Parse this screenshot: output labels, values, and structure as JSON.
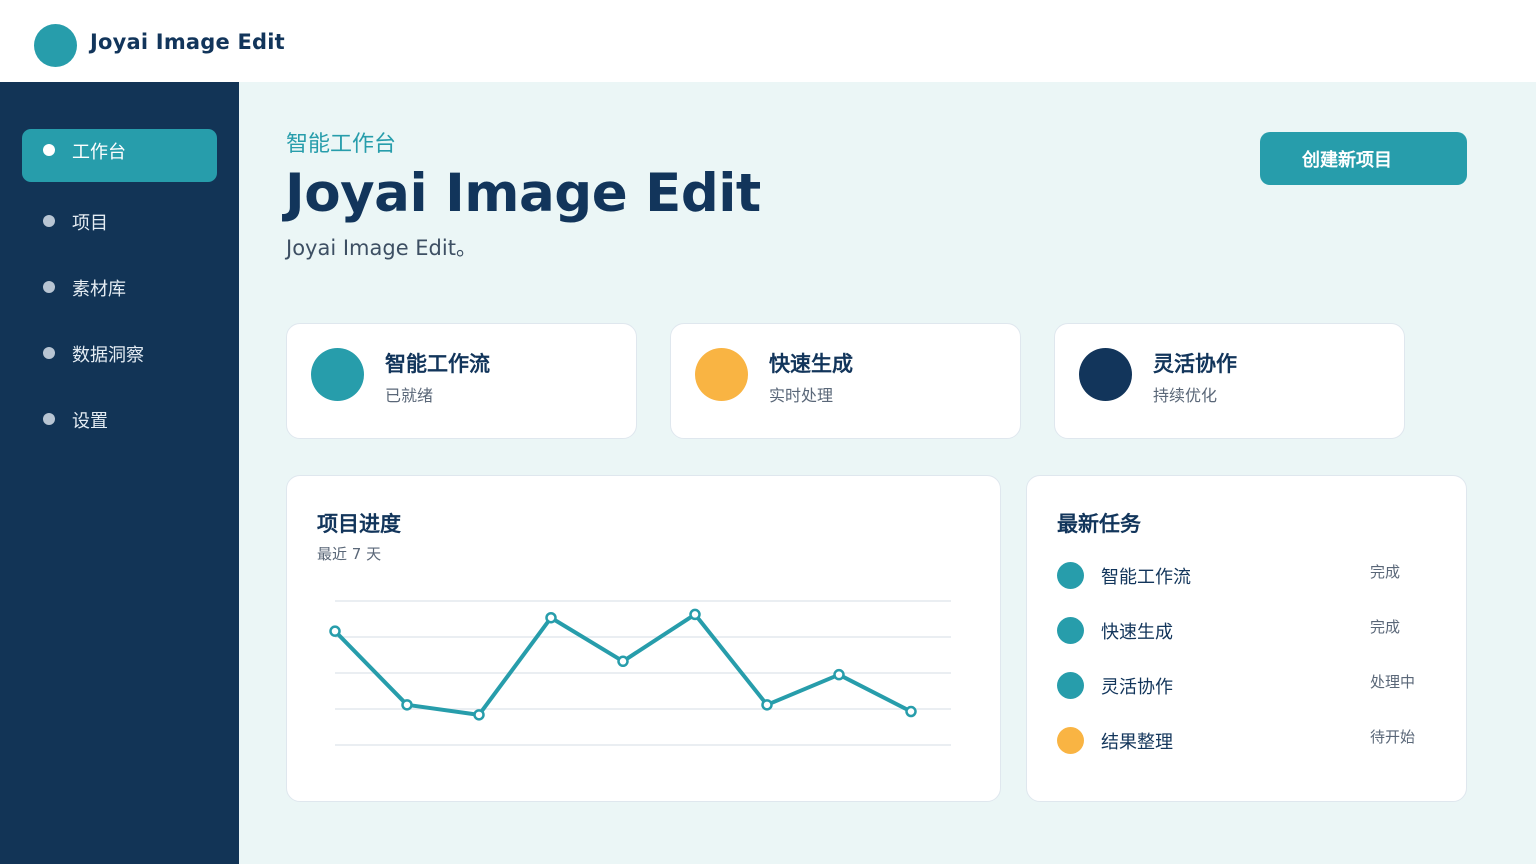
{
  "app": {
    "title": "Joyai Image Edit"
  },
  "colors": {
    "primary": "#279dab",
    "navy": "#12355b",
    "accent": "#f9b443",
    "sidebar": "#123456",
    "background": "#ebf6f6"
  },
  "sidebar": {
    "items": [
      {
        "label": "工作台",
        "active": true
      },
      {
        "label": "项目",
        "active": false
      },
      {
        "label": "素材库",
        "active": false
      },
      {
        "label": "数据洞察",
        "active": false
      },
      {
        "label": "设置",
        "active": false
      }
    ]
  },
  "header": {
    "eyebrow": "智能工作台",
    "title": "Joyai Image Edit",
    "description": "Joyai Image Edit。",
    "create_button": "创建新项目"
  },
  "features": [
    {
      "title": "智能工作流",
      "subtitle": "已就绪",
      "color": "#279dab"
    },
    {
      "title": "快速生成",
      "subtitle": "实时处理",
      "color": "#f9b443"
    },
    {
      "title": "灵活协作",
      "subtitle": "持续优化",
      "color": "#12355b"
    }
  ],
  "progress_panel": {
    "title": "项目进度",
    "subtitle": "最近 7 天"
  },
  "chart_data": {
    "type": "line",
    "title": "项目进度",
    "subtitle": "最近 7 天",
    "values": [
      31,
      9,
      6,
      35,
      22,
      36,
      9,
      18,
      7
    ],
    "ylim": [
      -3,
      40
    ],
    "grid": true,
    "color": "#279dab"
  },
  "tasks_panel": {
    "title": "最新任务",
    "items": [
      {
        "name": "智能工作流",
        "status": "完成",
        "color": "#279dab"
      },
      {
        "name": "快速生成",
        "status": "完成",
        "color": "#279dab"
      },
      {
        "name": "灵活协作",
        "status": "处理中",
        "color": "#279dab"
      },
      {
        "name": "结果整理",
        "status": "待开始",
        "color": "#f9b443"
      }
    ]
  }
}
